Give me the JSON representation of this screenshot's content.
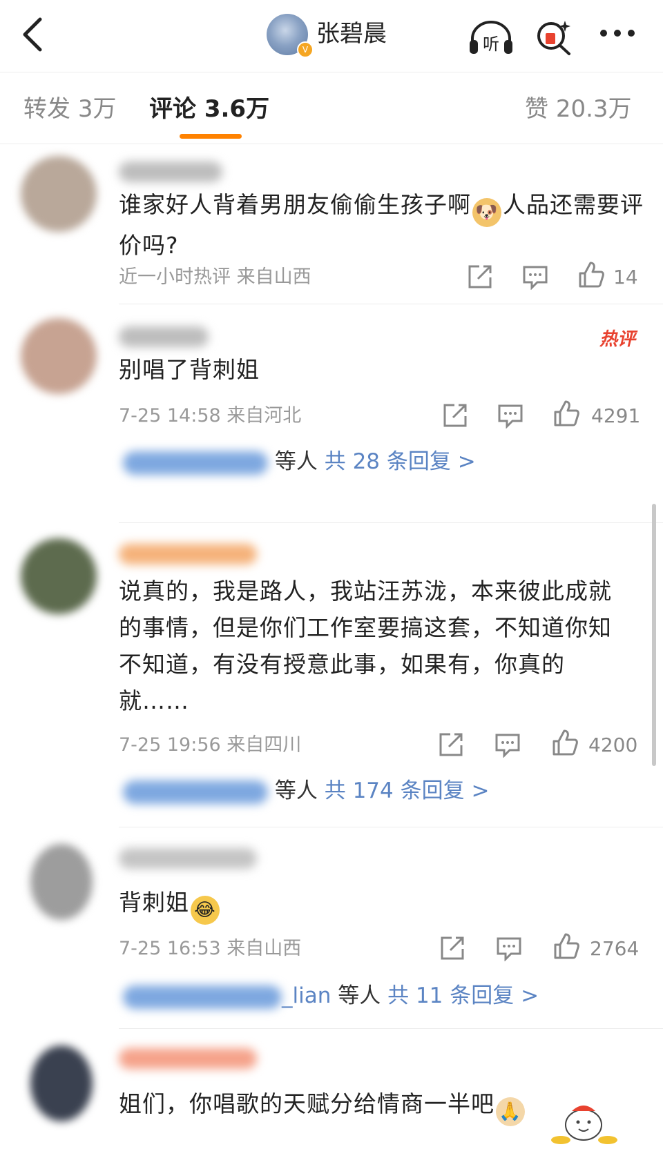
{
  "header": {
    "title": "张碧晨",
    "icons": [
      "back-arrow-icon",
      "headphones-listen-icon",
      "search-redpacket-icon",
      "more-icon"
    ],
    "listen_label": "听"
  },
  "tabs": [
    {
      "label": "转发",
      "count": "3万"
    },
    {
      "label": "评论",
      "count": "3.6万",
      "active": true
    },
    {
      "label": "赞",
      "count": "20.3万"
    }
  ],
  "comments": [
    {
      "text_1": "谁家好人背着男朋友偷偷生孩子啊",
      "emoji_1": "doge",
      "text_2": "人品还需要评价吗?",
      "meta": "近一小时热评  来自山西",
      "likes": "14",
      "hot": false
    },
    {
      "text": "别唱了背刺姐",
      "meta": "7-25 14:58 来自河北",
      "likes": "4291",
      "hot": true,
      "hot_label": "热评",
      "reply_suffix": "等人",
      "reply_link": "共 28 条回复 >"
    },
    {
      "text": "说真的，我是路人，我站汪苏泷，本来彼此成就的事情，但是你们工作室要搞这套，不知道你知不知道，有没有授意此事，如果有，你真的就……",
      "meta": "7-25 19:56 来自四川",
      "likes": "4200",
      "reply_suffix": "等人",
      "reply_link": "共 174 条回复 >"
    },
    {
      "text": "背刺姐",
      "emoji": "laugh-cry",
      "meta": "7-25 16:53 来自山西",
      "likes": "2764",
      "reply_visible": "_lian",
      "reply_suffix": "等人",
      "reply_link": "共 11 条回复 >"
    },
    {
      "text": "姐们，你唱歌的天赋分给情商一半吧",
      "emoji": "pray"
    }
  ],
  "colors": {
    "accent": "#ff8200",
    "link": "#5b84c3",
    "hot": "#e8422f",
    "meta": "#999999"
  }
}
